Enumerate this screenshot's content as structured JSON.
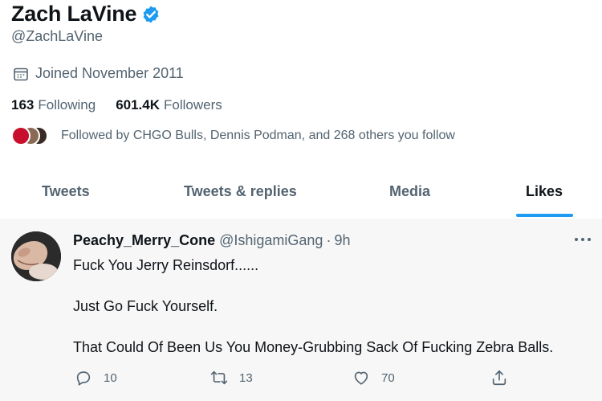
{
  "profile": {
    "name": "Zach LaVine",
    "handle": "@ZachLaVine",
    "joined": "Joined November 2011",
    "following_count": "163",
    "following_label": "Following",
    "followers_count": "601.4K",
    "followers_label": "Followers",
    "followed_by": "Followed by CHGO Bulls, Dennis Podman, and 268 others you follow"
  },
  "tabs": [
    {
      "label": "Tweets"
    },
    {
      "label": "Tweets & replies"
    },
    {
      "label": "Media"
    },
    {
      "label": "Likes",
      "active": true
    }
  ],
  "tweet": {
    "author_name": "Peachy_Merry_Cone",
    "author_handle": "@IshigamiGang",
    "separator": "·",
    "time": "9h",
    "lines": [
      "Fuck You Jerry Reinsdorf......",
      "Just Go Fuck Yourself.",
      "That Could Of Been Us You Money-Grubbing Sack Of Fucking Zebra Balls."
    ],
    "replies": "10",
    "retweets": "13",
    "likes": "70"
  },
  "colors": {
    "accent": "#1d9bf0",
    "secondary_text": "#536471",
    "primary_text": "#0f1419",
    "tweet_background": "#f7f7f7"
  },
  "icons": [
    "verified-badge-icon",
    "calendar-icon",
    "more-options-icon",
    "reply-icon",
    "retweet-icon",
    "like-icon",
    "share-icon"
  ]
}
